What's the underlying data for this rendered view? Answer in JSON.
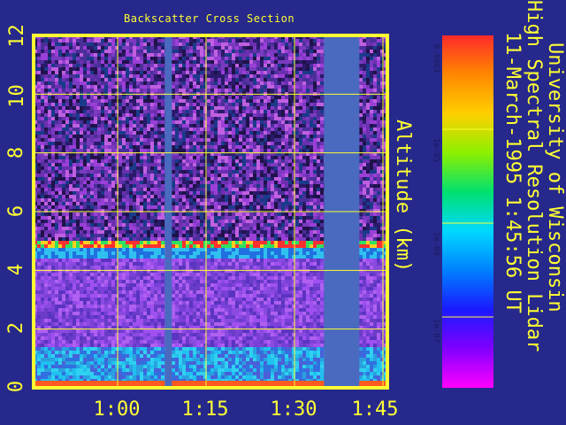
{
  "chart_data": {
    "type": "heatmap",
    "title": "Backscatter Cross Section",
    "ylabel": "Altitude (km)",
    "yticks": [
      "0",
      "2",
      "4",
      "6",
      "8",
      "10",
      "12"
    ],
    "ylim": [
      0,
      12
    ],
    "xticks": [
      "1:00",
      "1:15",
      "1:30",
      "1:45"
    ],
    "grid": true,
    "cloud_base_km": 4.9,
    "data_gaps": [
      {
        "start": "1:08",
        "end": "1:09"
      },
      {
        "start": "1:35",
        "end": "1:41"
      }
    ],
    "colorbar": {
      "scale": "log",
      "ticks": [
        "0.0001",
        "1e-05",
        "1e-06",
        "1e-07"
      ],
      "colors": [
        "#ff2a2a",
        "#ff8800",
        "#ffd000",
        "#8cf000",
        "#00e070",
        "#00d8ff",
        "#0080ff",
        "#1a1aff",
        "#8000ff",
        "#ff00ff"
      ]
    }
  },
  "header": {
    "line1": "University of Wisconsin",
    "line2": "High Spectral Resolution Lidar",
    "line3": "11-March-1995   1:45:56 UT"
  },
  "colors": {
    "background": "#26288c",
    "axis": "#ffff33",
    "grid": "#ffff33",
    "gap": "#4a6abf"
  }
}
